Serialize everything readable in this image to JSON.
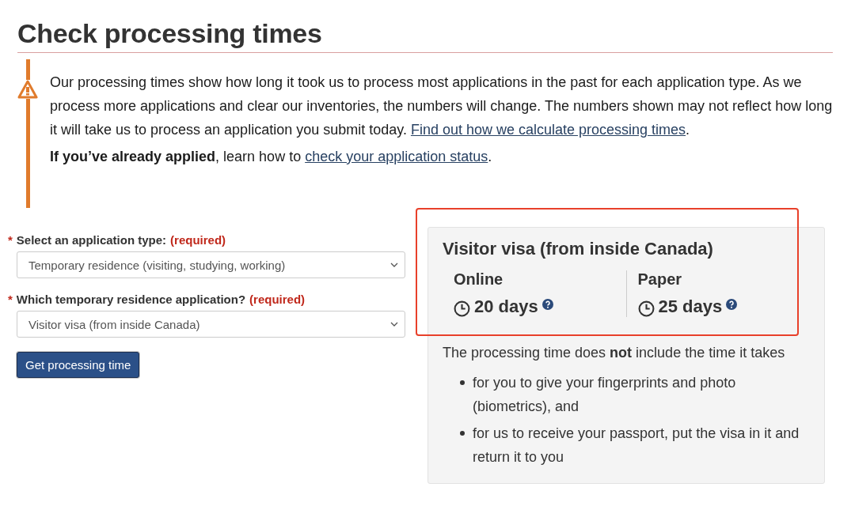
{
  "title": "Check processing times",
  "notice": {
    "paragraphs": [
      {
        "before": "Our processing times show how long it took us to process most applications in the past for each application type. As we process more applications and clear our inventories, the numbers will change. The numbers shown may not reflect how long it will take us to process an application you submit today. ",
        "link": "Find out how we calculate processing times",
        "after": "."
      },
      {
        "before": "**If you’ve already applied**, learn how to ",
        "link": "check your application status",
        "after": "."
      }
    ]
  },
  "form": {
    "fields": [
      {
        "asterisk": "*",
        "label": "Select an application type:",
        "required": "(required)",
        "value": "Temporary residence (visiting, studying, working)"
      },
      {
        "asterisk": "*",
        "label": "Which temporary residence application?",
        "required": "(required)",
        "value": "Visitor visa (from inside Canada)"
      }
    ],
    "button": "Get processing time"
  },
  "result": {
    "highlighted": true,
    "title": "Visitor visa (from inside Canada)",
    "options": [
      {
        "label": "Online",
        "time": "20 days"
      },
      {
        "label": "Paper",
        "time": "25 days"
      }
    ],
    "note": "The processing time does **not** include the time it takes",
    "bullets": [
      "for you to give your fingerprints and photo (biometrics), and",
      "for us to receive your passport, put the visa in it and return it to you"
    ]
  }
}
